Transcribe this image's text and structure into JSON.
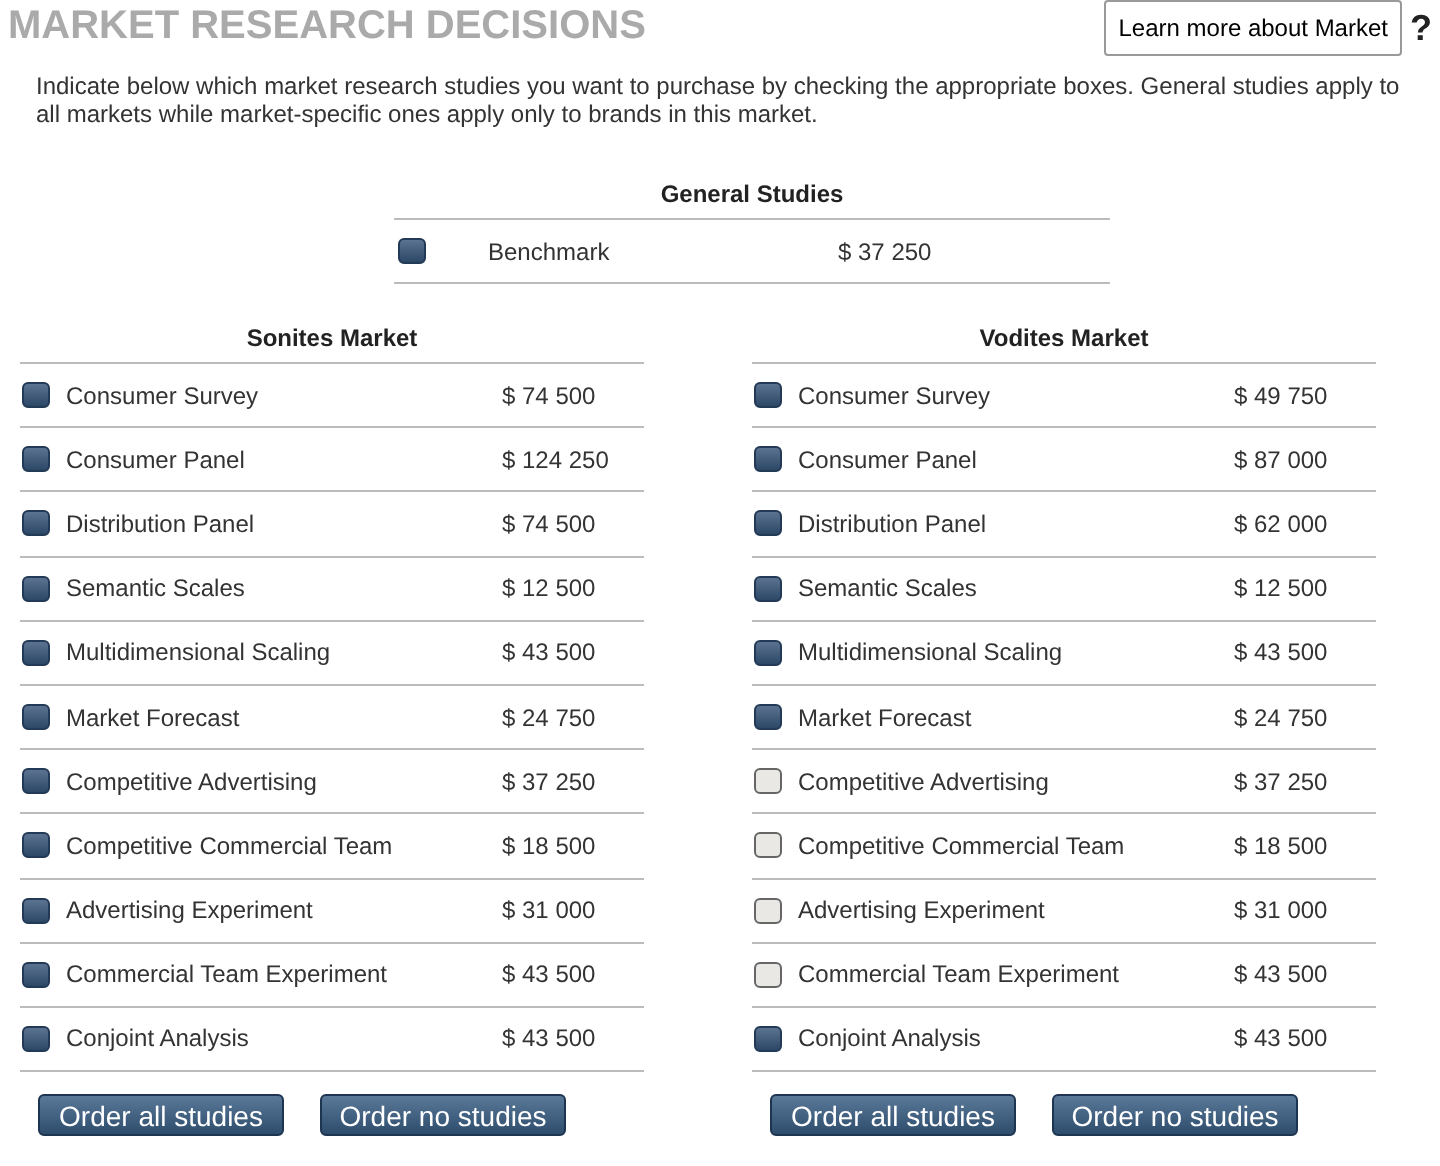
{
  "title": "MARKET RESEARCH DECISIONS",
  "help_button": {
    "label": "Learn more about Market",
    "icon": "?"
  },
  "intro": "Indicate below which market research studies you want to purchase by checking the appropriate boxes. General studies apply to all markets while market-specific ones apply only to brands in this market.",
  "general": {
    "heading": "General Studies",
    "rows": [
      {
        "name": "Benchmark",
        "price": "$ 37 250",
        "checked": true
      }
    ]
  },
  "markets": [
    {
      "heading": "Sonites Market",
      "rows": [
        {
          "name": "Consumer Survey",
          "price": "$ 74 500",
          "checked": true
        },
        {
          "name": "Consumer Panel",
          "price": "$ 124 250",
          "checked": true
        },
        {
          "name": "Distribution Panel",
          "price": "$ 74 500",
          "checked": true
        },
        {
          "name": "Semantic Scales",
          "price": "$ 12 500",
          "checked": true
        },
        {
          "name": "Multidimensional Scaling",
          "price": "$ 43 500",
          "checked": true
        },
        {
          "name": "Market Forecast",
          "price": "$ 24 750",
          "checked": true
        },
        {
          "name": "Competitive Advertising",
          "price": "$ 37 250",
          "checked": true
        },
        {
          "name": "Competitive Commercial Team",
          "price": "$ 18 500",
          "checked": true
        },
        {
          "name": "Advertising Experiment",
          "price": "$ 31 000",
          "checked": true
        },
        {
          "name": "Commercial Team Experiment",
          "price": "$ 43 500",
          "checked": true
        },
        {
          "name": "Conjoint Analysis",
          "price": "$ 43 500",
          "checked": true
        }
      ],
      "buttons": [
        "Order all studies",
        "Order no studies"
      ]
    },
    {
      "heading": "Vodites Market",
      "rows": [
        {
          "name": "Consumer Survey",
          "price": "$ 49 750",
          "checked": true
        },
        {
          "name": "Consumer Panel",
          "price": "$ 87 000",
          "checked": true
        },
        {
          "name": "Distribution Panel",
          "price": "$ 62 000",
          "checked": true
        },
        {
          "name": "Semantic Scales",
          "price": "$ 12 500",
          "checked": true
        },
        {
          "name": "Multidimensional Scaling",
          "price": "$ 43 500",
          "checked": true
        },
        {
          "name": "Market Forecast",
          "price": "$ 24 750",
          "checked": true
        },
        {
          "name": "Competitive Advertising",
          "price": "$ 37 250",
          "checked": false
        },
        {
          "name": "Competitive Commercial Team",
          "price": "$ 18 500",
          "checked": false
        },
        {
          "name": "Advertising Experiment",
          "price": "$ 31 000",
          "checked": false
        },
        {
          "name": "Commercial Team Experiment",
          "price": "$ 43 500",
          "checked": false
        },
        {
          "name": "Conjoint Analysis",
          "price": "$ 43 500",
          "checked": true
        }
      ],
      "buttons": [
        "Order all studies",
        "Order no studies"
      ]
    }
  ]
}
